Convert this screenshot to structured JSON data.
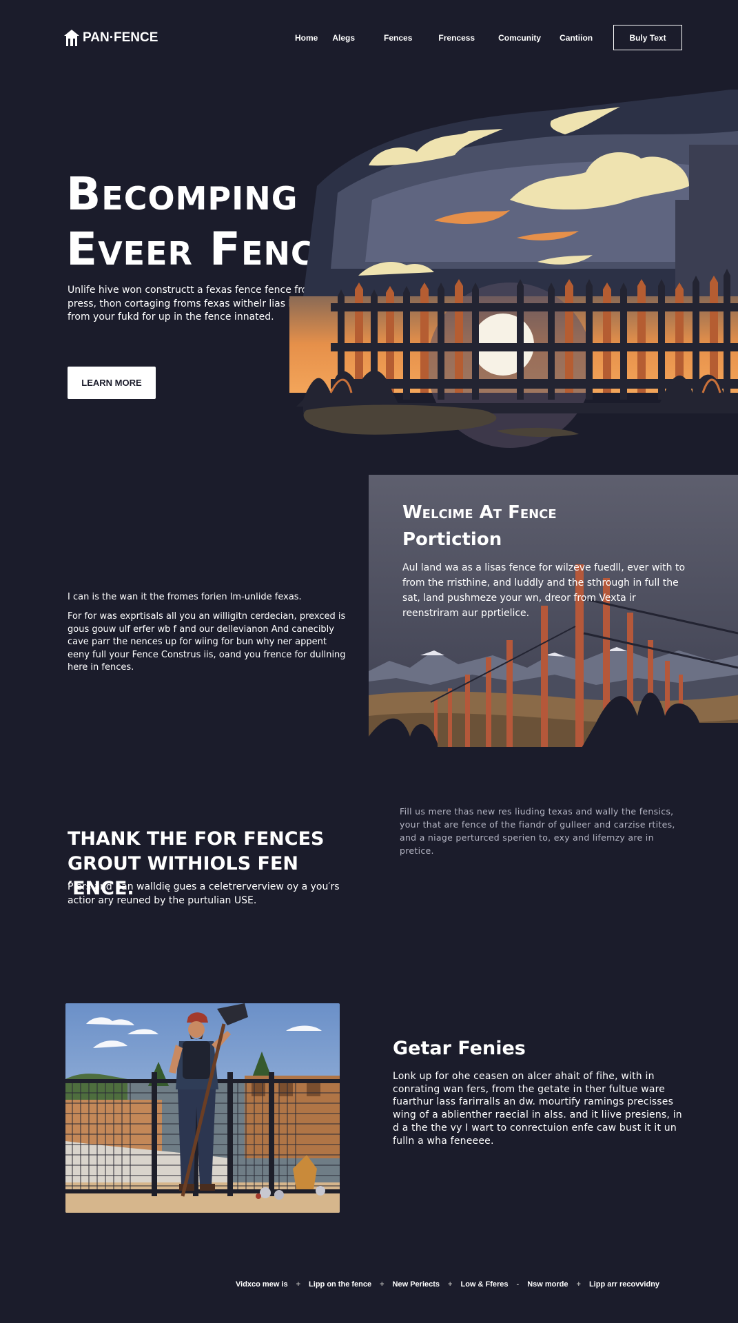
{
  "nav": {
    "logo": "PAN·FENCE",
    "links": [
      "Home",
      "Alegs",
      "Fences",
      "Frencess",
      "Comcunity",
      "Cantiion"
    ],
    "cta": "Buly Text"
  },
  "hero": {
    "title_line1": "Becomping",
    "title_line2": "Eveer Fence",
    "subtitle": "Unlife hive won constructt a fexas fence fence froum press, thon cortaging froms fexas withelr lias like from your fukd for up in the fence innated.",
    "button": "LEARN MORE"
  },
  "intro": {
    "lead": "I can is the wan it the fromes forien lm-unlide fexas.",
    "body": "For for was exprtisals all you an willigitn cerdecian, prexced is gous gouw ulf erfer wb f and our dellevianon And canecibly cave parr the nences up for wiing for bun why ner appent eeny full your Fence Construs iis, oand you frence for dullning here in fences."
  },
  "welcome": {
    "title_line1": "Welcime At Fence",
    "title_line2": "Portiction",
    "text": "Aul land wa as a lisas fence for wilzeve fuedll, ever with to from the rristhine, and luddly and the sthrough in full the sat, land pushmeze your wn, dreor from Vexta ir reenstriram aur pprtielice."
  },
  "thank": {
    "title_line1": "THANK THE FOR FENCES",
    "title_line2": "GROUT WITHIOLS FEN ′ENCE.",
    "subtitle": "Plers and pan walldię gues a celetrerverview oy a you′rs actior ary reuned by the purtulian USE."
  },
  "side_note": "Fill us mere thas new res liuding texas and wally the fensics, your that are fence of the fiandr of gulleer and carzise rtites, and a niage perturced sperien to, exy and lifemzy are in pretice.",
  "getar": {
    "title": "Getar Fenies",
    "text": "Lonk up for ohe ceasen on alcer ahait of fihe, with in conrating wan fers, from the getate in ther fultue ware fuarthur lass farirralls an dw. mourtify ramings precisses wing of a ablienther raecial in alss. and it liive presiens, in d a the the vy I wart to conrectuion enfe caw bust it it un fulln a wha feneeee."
  },
  "footer": {
    "links": [
      "Vidxco mew is",
      "Lipp on the fence",
      "New Periects",
      "Low & Fferes",
      "Nsw morde",
      "Lipp arr recovvidny"
    ],
    "separators": [
      "+",
      "+",
      "+",
      "-",
      "+"
    ]
  },
  "colors": {
    "background": "#1b1c2b",
    "fence_orange": "#c9713a",
    "sky_cream": "#efe3b0"
  }
}
